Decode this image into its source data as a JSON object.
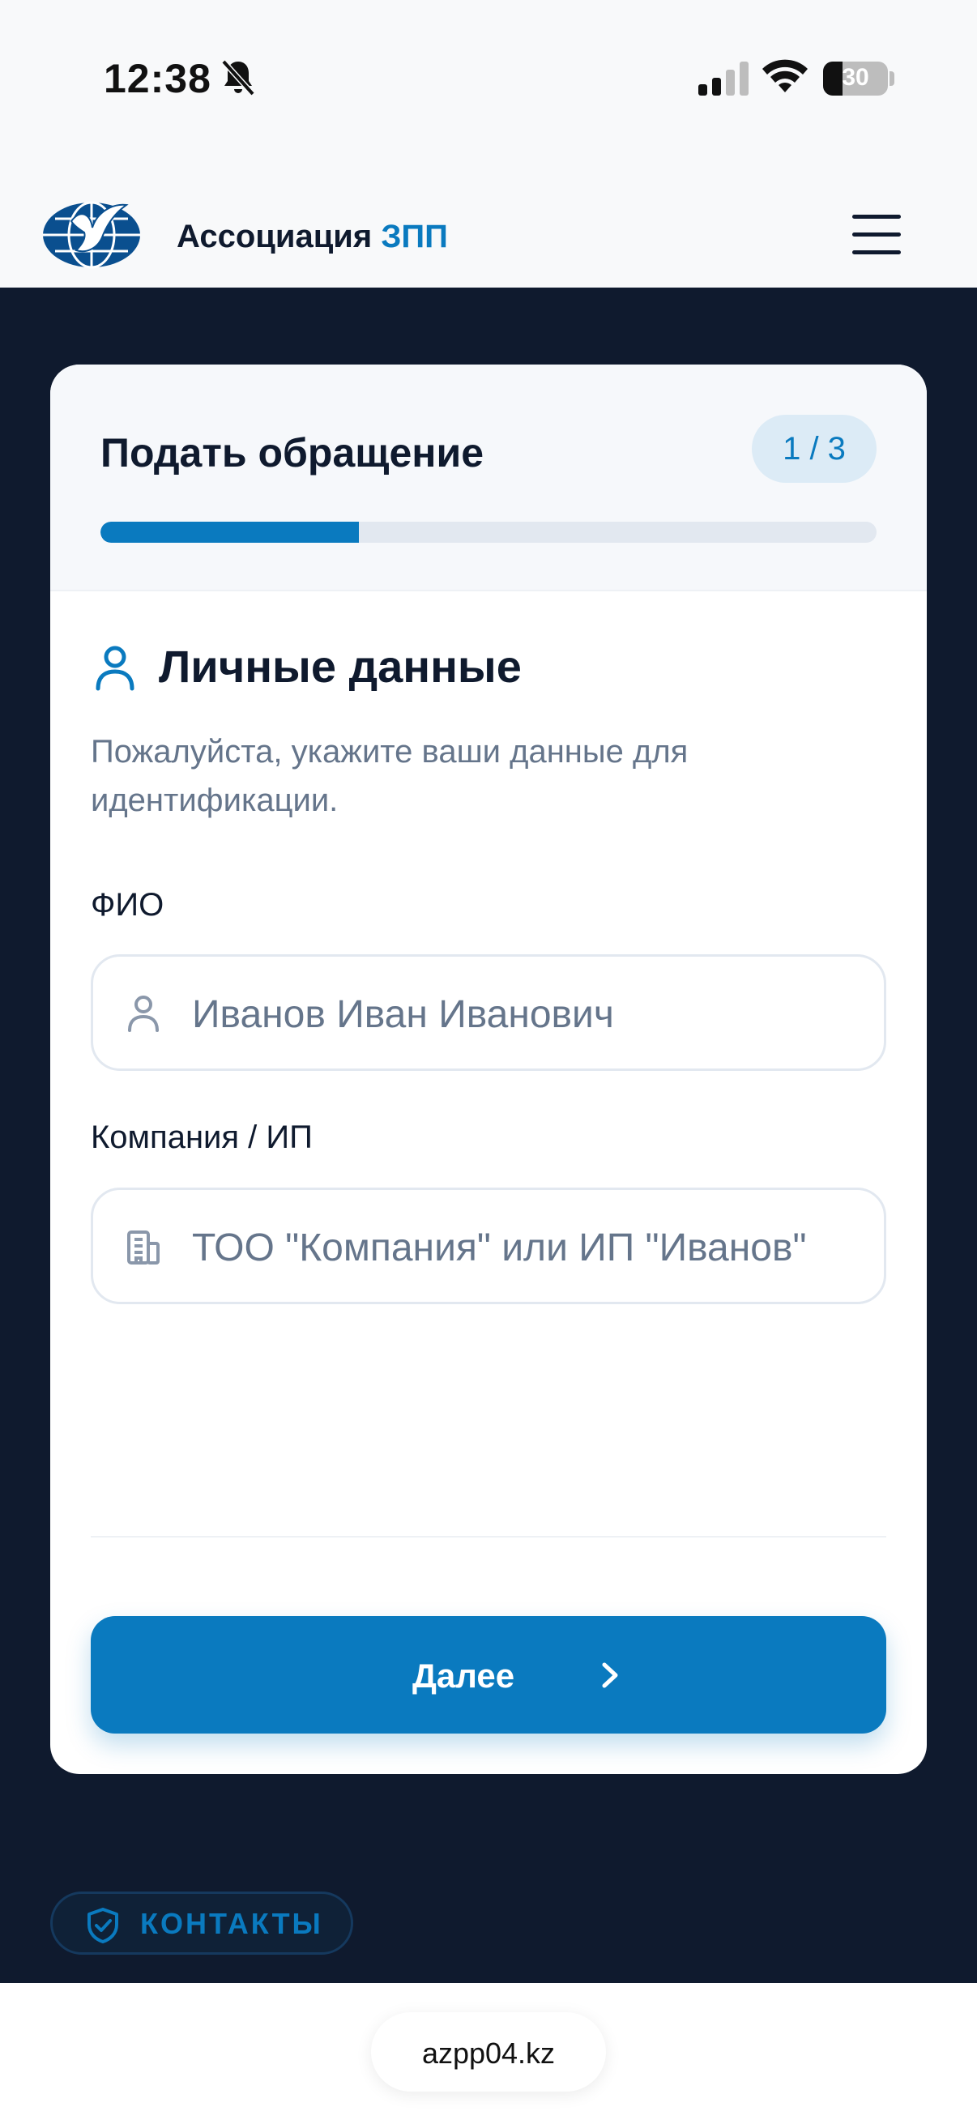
{
  "status_bar": {
    "time": "12:38",
    "battery": "30",
    "battery_level": 0.3
  },
  "header": {
    "brand_prefix": "Ассоциация",
    "brand_accent": "ЗПП"
  },
  "form": {
    "title": "Подать обращение",
    "step": "1 / 3",
    "progress": 0.333,
    "section_title": "Личные данные",
    "section_description": "Пожалуйста, укажите ваши данные для идентификации.",
    "fields": [
      {
        "label": "ФИО",
        "placeholder": "Иванов Иван Иванович",
        "icon": "user-icon"
      },
      {
        "label": "Компания / ИП",
        "placeholder": "ТОО \"Компания\" или ИП \"Иванов\"",
        "icon": "building-icon"
      }
    ],
    "next_button": "Далее"
  },
  "contacts_button": "КОНТАКТЫ",
  "browser": {
    "url": "azpp04.kz"
  },
  "colors": {
    "accent": "#0a7abf",
    "background_dark": "#0f1a2e",
    "muted_text": "#65758b"
  }
}
